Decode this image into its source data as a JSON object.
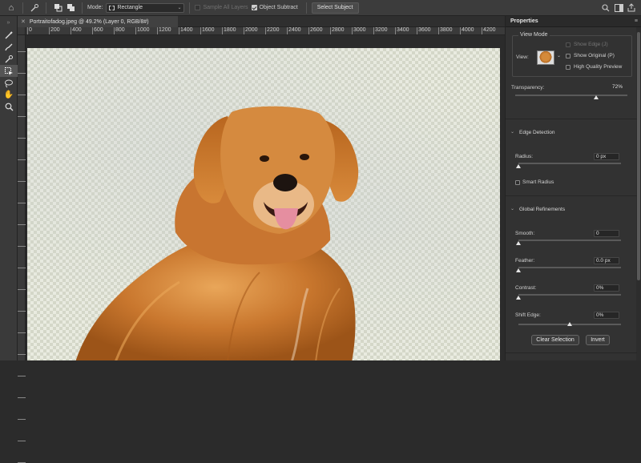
{
  "options_bar": {
    "mode_label": "Mode:",
    "mode_value": "Rectangle",
    "sample_all_layers": "Sample All Layers",
    "sample_all_layers_checked": false,
    "object_subtract": "Object Subtract",
    "object_subtract_checked": true,
    "select_subject": "Select Subject"
  },
  "document": {
    "tab_title": "Portraitofadog.jpeg @ 49.2% (Layer 0, RGB/8#)"
  },
  "ruler": {
    "h_ticks": [
      "0",
      "200",
      "400",
      "600",
      "800",
      "1000",
      "1200",
      "1400",
      "1600",
      "1800",
      "2000",
      "2200",
      "2400",
      "2600",
      "2800",
      "3000",
      "3200",
      "3400",
      "3600",
      "3800",
      "4000",
      "4200"
    ]
  },
  "properties": {
    "panel_title": "Properties",
    "view_mode": {
      "title": "View Mode",
      "view_label": "View:",
      "show_edge": "Show Edge (J)",
      "show_original": "Show Original (P)",
      "high_quality_preview": "High Quality Preview"
    },
    "transparency": {
      "label": "Transparency:",
      "value": "72%",
      "level": 0.72
    },
    "edge_detection": {
      "title": "Edge Detection",
      "radius_label": "Radius:",
      "radius_value": "0 px",
      "radius_level": 0,
      "smart_radius": "Smart Radius"
    },
    "global_refinements": {
      "title": "Global Refinements",
      "smooth_label": "Smooth:",
      "smooth_value": "0",
      "smooth_level": 0,
      "feather_label": "Feather:",
      "feather_value": "0.0 px",
      "feather_level": 0,
      "contrast_label": "Contrast:",
      "contrast_value": "0%",
      "contrast_level": 0,
      "shift_edge_label": "Shift Edge:",
      "shift_edge_value": "0%",
      "shift_edge_level": 0.5
    },
    "buttons": {
      "clear_selection": "Clear Selection",
      "invert": "Invert"
    }
  },
  "colors": {
    "panel_bg": "#323232",
    "canvas_check_a": "#e9ebe0",
    "canvas_check_b": "#d4d7c8",
    "fur_main": "#c9772e"
  }
}
